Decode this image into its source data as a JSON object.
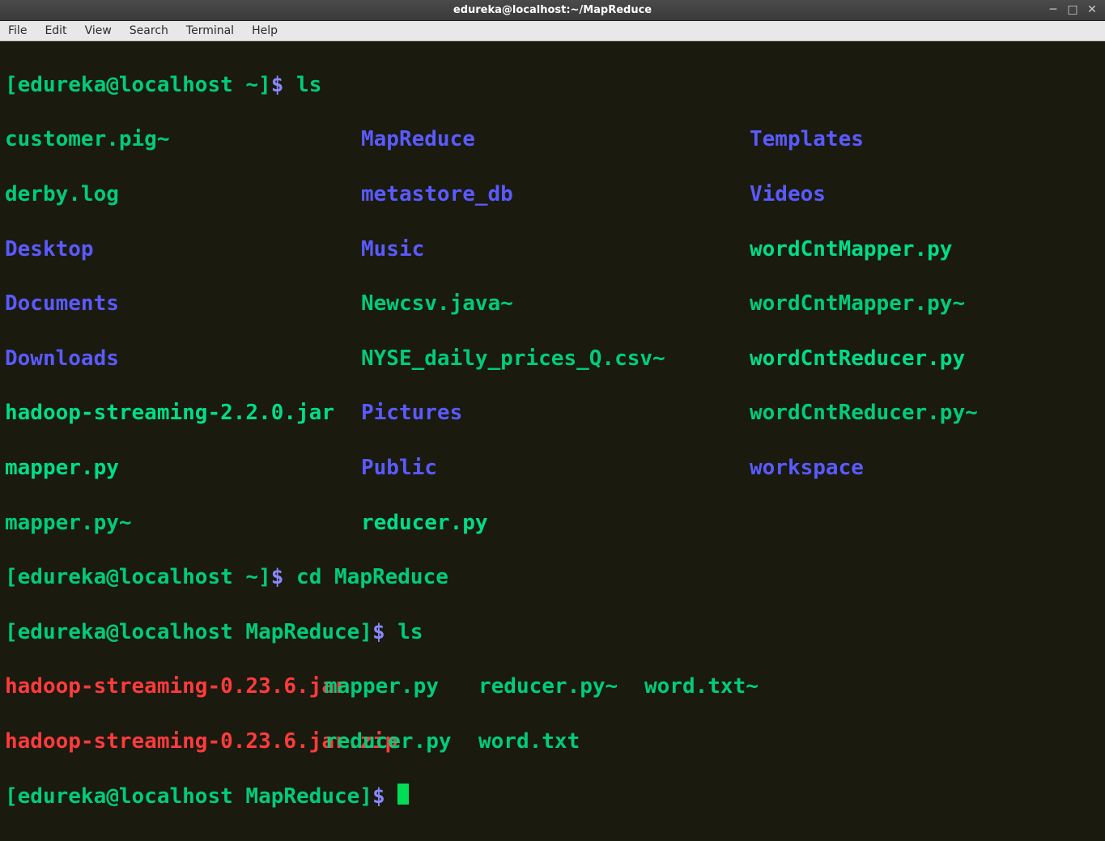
{
  "window": {
    "title": "edureka@localhost:~/MapReduce"
  },
  "menu": {
    "file": "File",
    "edit": "Edit",
    "view": "View",
    "search": "Search",
    "terminal": "Terminal",
    "help": "Help"
  },
  "term": {
    "prompt1_user": "[edureka@localhost ~]",
    "prompt1_dollar": "$ ",
    "cmd1": "ls",
    "ls1": {
      "r1c1": "customer.pig~",
      "r1c2": "MapReduce",
      "r1c3": "Templates",
      "r2c1": "derby.log",
      "r2c2": "metastore_db",
      "r2c3": "Videos",
      "r3c1": "Desktop",
      "r3c2": "Music",
      "r3c3": "wordCntMapper.py",
      "r4c1": "Documents",
      "r4c2": "Newcsv.java~",
      "r4c3": "wordCntMapper.py~",
      "r5c1": "Downloads",
      "r5c2": "NYSE_daily_prices_Q.csv~",
      "r5c3": "wordCntReducer.py",
      "r6c1": "hadoop-streaming-2.2.0.jar",
      "r6c2": "Pictures",
      "r6c3": "wordCntReducer.py~",
      "r7c1": "mapper.py",
      "r7c2": "Public",
      "r7c3": "workspace",
      "r8c1": "mapper.py~",
      "r8c2": "reducer.py"
    },
    "prompt2_user": "[edureka@localhost ~]",
    "prompt2_dollar": "$ ",
    "cmd2": "cd MapReduce",
    "prompt3_user": "[edureka@localhost MapReduce]",
    "prompt3_dollar": "$ ",
    "cmd3": "ls",
    "ls2": {
      "r1c1": "hadoop-streaming-0.23.6.jar",
      "r1c2": "mapper.py",
      "r1c3": "reducer.py~",
      "r1c4": "word.txt~",
      "r2c1": "hadoop-streaming-0.23.6.jar.zip",
      "r2c2": "reducer.py",
      "r2c3": "word.txt"
    },
    "prompt4_user": "[edureka@localhost MapReduce]",
    "prompt4_dollar": "$ "
  }
}
